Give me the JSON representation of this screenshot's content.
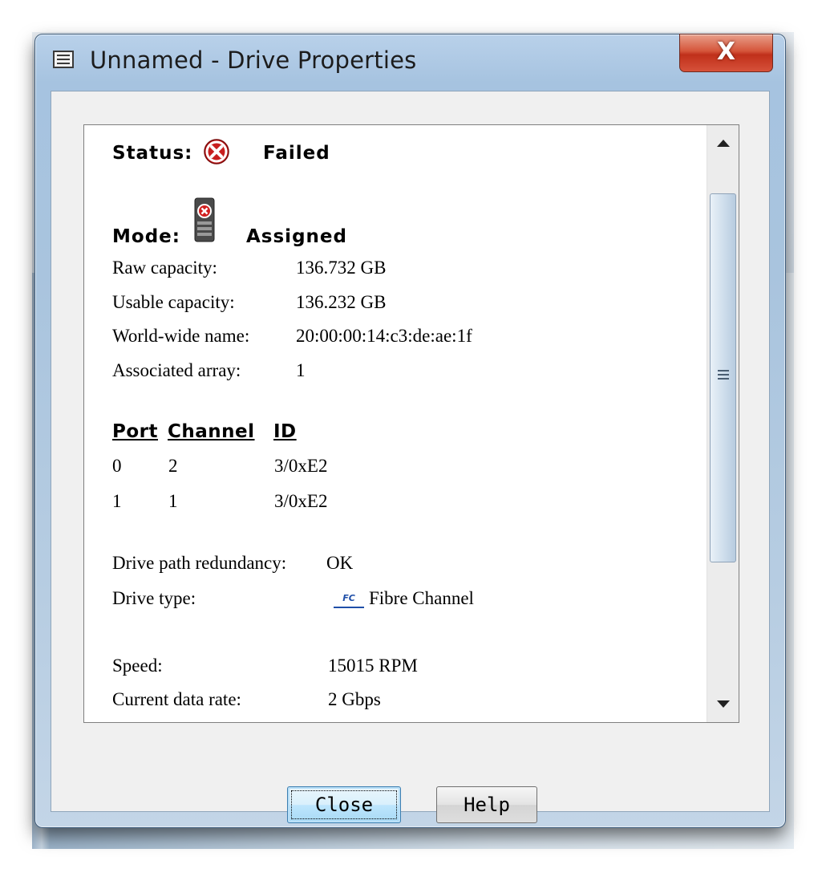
{
  "window": {
    "title": "Unnamed - Drive Properties",
    "close_glyph": "X"
  },
  "status": {
    "label": "Status:",
    "value": "Failed",
    "icon": "failed-icon"
  },
  "mode": {
    "label": "Mode:",
    "value": "Assigned",
    "icon": "drive-failed-icon"
  },
  "details": [
    {
      "label": "Raw capacity:",
      "value": "136.732 GB"
    },
    {
      "label": "Usable capacity:",
      "value": "136.232 GB"
    },
    {
      "label": "World-wide name:",
      "value": "20:00:00:14:c3:de:ae:1f"
    },
    {
      "label": "Associated array:",
      "value": "1"
    }
  ],
  "ports": {
    "headers": [
      "Port",
      "Channel",
      "ID"
    ],
    "rows": [
      [
        "0",
        "2",
        "3/0xE2"
      ],
      [
        "1",
        "1",
        "3/0xE2"
      ]
    ]
  },
  "redundancy": {
    "label": "Drive path redundancy:",
    "value": "OK"
  },
  "drive_type": {
    "label": "Drive type:",
    "badge": "FC",
    "value": "Fibre Channel"
  },
  "speed": {
    "label": "Speed:",
    "value": "15015 RPM"
  },
  "data_rate": {
    "label": "Current data rate:",
    "value": "2 Gbps"
  },
  "buttons": {
    "close": "Close",
    "help": "Help"
  }
}
